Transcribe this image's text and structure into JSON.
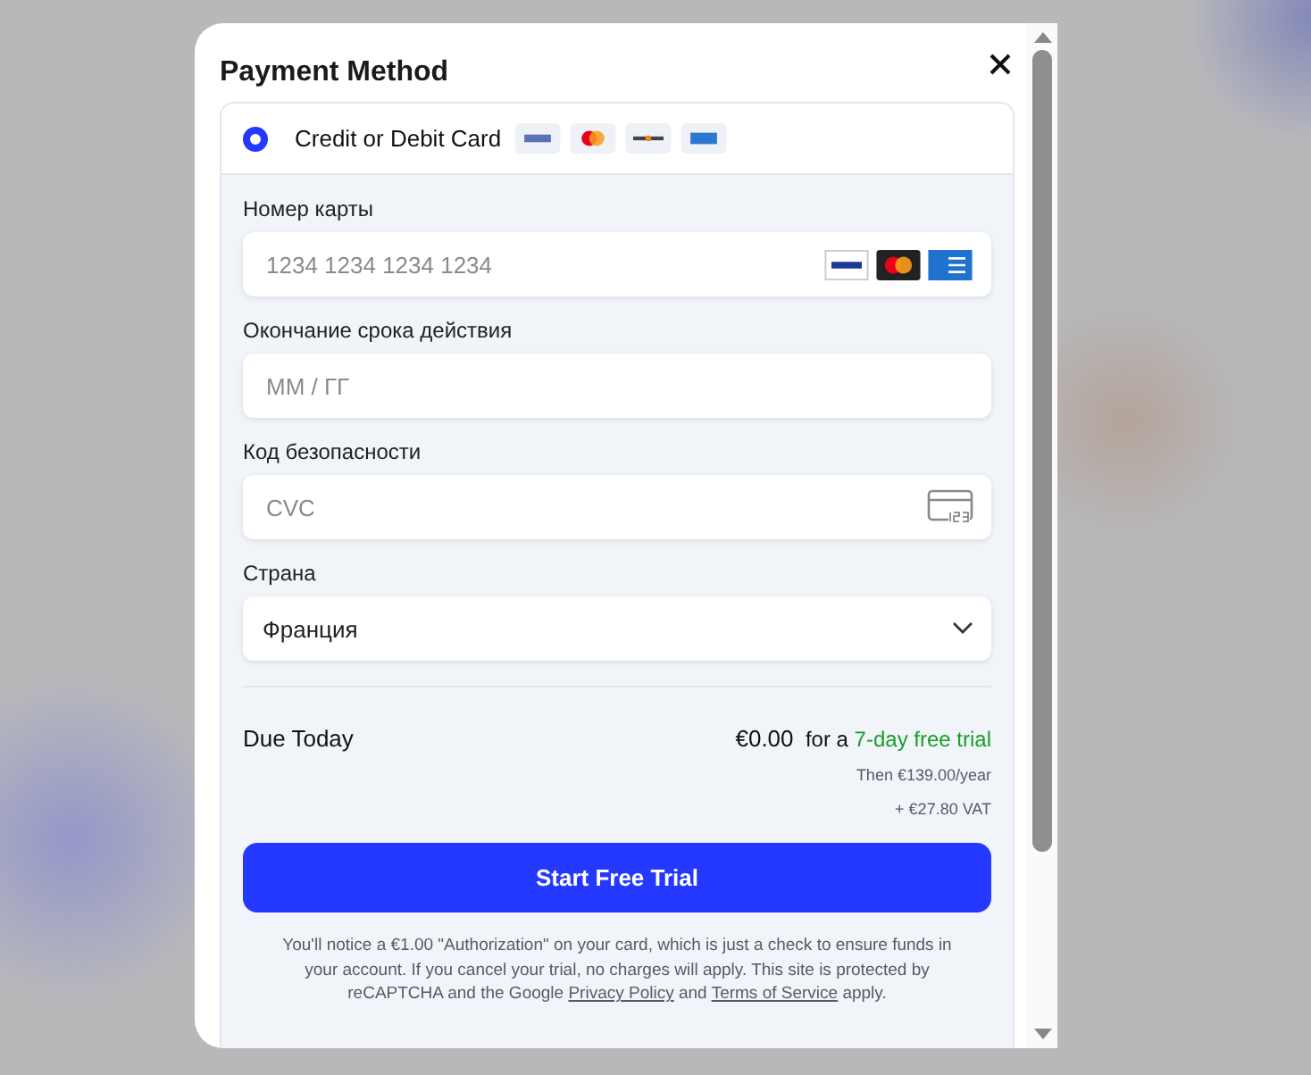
{
  "modal": {
    "title": "Payment Method"
  },
  "payment_option": {
    "label": "Credit or Debit Card",
    "selected": true
  },
  "fields": [
    {
      "kind": "card",
      "label": "Номер карты",
      "placeholder": "1234 1234 1234 1234"
    },
    {
      "kind": "text",
      "label": "Окончание срока действия",
      "placeholder": "ММ / ГГ"
    },
    {
      "kind": "cvc",
      "label": "Код безопасности",
      "placeholder": "CVC"
    },
    {
      "kind": "select",
      "label": "Страна",
      "value": "Франция"
    }
  ],
  "summary": {
    "label": "Due Today",
    "amount": "€0.00",
    "trial_prefix": "for a",
    "trial_highlight": "7-day free trial",
    "then": "Then €139.00/year",
    "vat": "+ €27.80 VAT"
  },
  "submit_button": "Start Free Trial",
  "notice": {
    "text_before": "You'll notice a €1.00 \"Authorization\" on your card, which is just a check to ensure funds in your account. If you cancel your trial, no charges will apply. This site is protected by reCAPTCHA and the Google",
    "link_1": "Privacy Policy",
    "text_middle": "and",
    "link_2": "Terms of Service",
    "text_after": "apply."
  }
}
